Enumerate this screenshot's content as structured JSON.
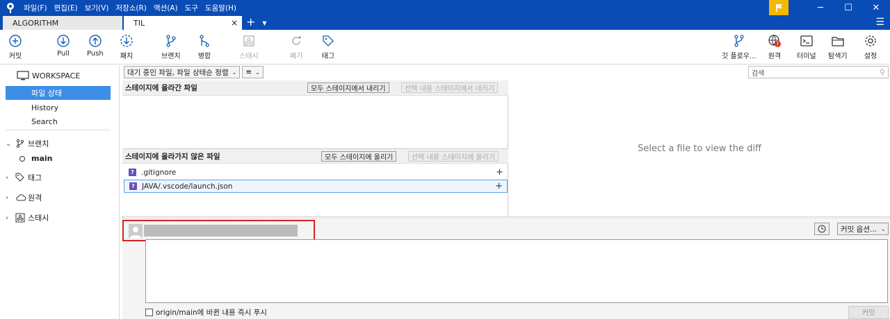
{
  "menu": [
    "파일(F)",
    "편집(E)",
    "보기(V)",
    "저장소(R)",
    "액션(A)",
    "도구",
    "도움말(H)"
  ],
  "tabs": [
    {
      "label": "ALGORITHM",
      "active": false
    },
    {
      "label": "TIL",
      "active": true
    }
  ],
  "tab_add": "+",
  "tab_close": "×",
  "toolbar": {
    "commit": "커밋",
    "pull": "Pull",
    "push": "Push",
    "fetch": "패치",
    "branch": "브랜치",
    "merge": "병합",
    "stash": "스태시",
    "discard": "폐기",
    "tag": "태그",
    "gitflow": "깃 플로우...",
    "remote": "원격",
    "terminal": "터미널",
    "explorer": "탐색기",
    "settings": "설정"
  },
  "sidebar": {
    "workspace": "WORKSPACE",
    "items": [
      "파일 상태",
      "History",
      "Search"
    ],
    "branches": "브랜치",
    "current_branch": "main",
    "tags": "태그",
    "remotes": "원격",
    "stashes": "스태시"
  },
  "filter": {
    "view_mode": "대기 중인 파일, 파일 상태순 정렬",
    "list_icon": "≡"
  },
  "search": {
    "placeholder": "검색"
  },
  "staged": {
    "header": "스테이지에 올라간 파일",
    "unstage_all": "모두 스테이지에서 내리기",
    "unstage_selected": "선택 내용 스테이지에서 내리기",
    "files": []
  },
  "unstaged": {
    "header": "스테이지에 올라가지 않은 파일",
    "stage_all": "모두 스테이지에 올리기",
    "stage_selected": "선택 내용 스테이지에 올리기",
    "files": [
      ".gitignore",
      "JAVA/.vscode/launch.json"
    ]
  },
  "diff": {
    "placeholder": "Select a file to view the diff"
  },
  "commit": {
    "options": "커밋 옵션...",
    "push_label": "origin/main에 바뀐 내용 즉시 푸시",
    "button": "커밋"
  },
  "colors": {
    "accent": "#0a4cb5",
    "selection": "#3d8ee6",
    "highlight": "#d42020",
    "flag": "#f5b800",
    "file_icon": "#6b4fbb"
  }
}
